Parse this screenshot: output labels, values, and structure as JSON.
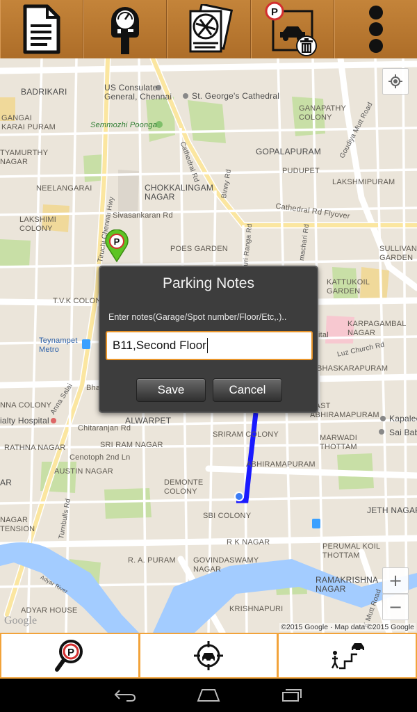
{
  "toolbar": {
    "items": [
      {
        "name": "notes",
        "icon": "document-icon"
      },
      {
        "name": "meter",
        "icon": "parking-meter-icon"
      },
      {
        "name": "maps",
        "icon": "folded-map-icon"
      },
      {
        "name": "clear",
        "icon": "parking-clear-trash-icon"
      },
      {
        "name": "overflow",
        "icon": "more-vert-icon"
      }
    ]
  },
  "map": {
    "labels": {
      "badrikari": "BADRIKARI",
      "us_consulate": "US Consulate\nGeneral, Chennai",
      "st_george": "St. George's Cathedral",
      "gangai": "GANGAI\nKARAI PURAM",
      "semmozhi": "Semmozhi Poonga",
      "ganapathy": "GANAPATHY\nCOLONY",
      "goudiya": "Goudiya Mutt Road",
      "tyamurthy": "TYAMURTHY\nNAGAR",
      "cathedral_rd_v": "Cathedral Rd",
      "gopalapuram": "GOPALAPURAM",
      "pudupet": "PUDUPET",
      "neelangarai": "NEELANGARAI",
      "chokkalingam": "CHOKKALINGAM\nNAGAR",
      "lakshmipuram": "LAKSHMIPURAM",
      "tiruchi": "Tiruchi Chennai Hwy",
      "sivasankaran": "Sivasankaran Rd",
      "binny": "Binny Rd",
      "cathedral_flyover": "Cathedral Rd Flyover",
      "lakshimi": "LAKSHIMI\nCOLONY",
      "poes": "POES GARDEN",
      "ranga": "uri Ranga Rd",
      "machari": "machari Rd",
      "sullivan": "SULLIVAN\nGARDEN",
      "tvk": "T.V.K COLONY",
      "kattukoil": "KATTUKOIL\nGARDEN",
      "teynampet": "Teynampet\nMetro",
      "karpagambal": "KARPAGAMBAL\nNAGAR",
      "luz": "Luz Church Rd",
      "bhaskarapuram": "BHASKARAPURAM",
      "bha": "Bha",
      "ital": "ital",
      "anna_salai": "Anna Salai",
      "nna_colony": "NNA COLONY",
      "alwarpet": "ALWARPET",
      "sriram": "SRIRAM COLONY",
      "east_abhi": "EAST\nABHIRAMAPURAM",
      "kapalee": "Kapalee",
      "sai_baba": "Sai Baba",
      "hospital": "ialty Hospital",
      "chitaranjan": "Chitaranjan Rd",
      "rathna": "RATHNA NAGAR",
      "sri_ram": "SRI RAM NAGAR",
      "cenotoph": "Cenotoph 2nd Ln",
      "austin": "AUSTIN NAGAR",
      "marwadi": "MARWADI\nTHOTTAM",
      "abhiramapuram": "ABHIRAMAPURAM",
      "demonte": "DEMONTE\nCOLONY",
      "ar": "AR",
      "jeth": "JETH NAGAR",
      "sbi": "SBI COLONY",
      "turnbulls": "Turnbulls Rd",
      "nagar_tension": "NAGAR\nTENSION",
      "rk_nagar": "R K NAGAR",
      "perumal": "PERUMAL KOIL\nTHOTTAM",
      "ra_puram": "R. A. PURAM",
      "govindaswamy": "GOVINDASWAMY\nNAGAR",
      "adyar_river": "Adyar River",
      "ramakrishna": "RAMAKRISHNA\nNAGAR",
      "adyar_house": "ADYAR HOUSE",
      "krishnapuri": "KRISHNAPURI",
      "kmutt": "K Mutt Road"
    },
    "zoom_in": "+",
    "zoom_out": "−",
    "google_logo": "Google",
    "copyright": "©2015 Google · Map data ©2015 Google"
  },
  "dialog": {
    "title": "Parking Notes",
    "hint": "Enter notes(Garage/Spot number/Floor/Etc,.)..",
    "input_value": "B11,Second Floor",
    "save_label": "Save",
    "cancel_label": "Cancel"
  },
  "bottombar": {
    "items": [
      {
        "name": "find-parking",
        "icon": "parking-search-icon"
      },
      {
        "name": "locate-car",
        "icon": "car-target-icon"
      },
      {
        "name": "walk-to-car",
        "icon": "walk-to-car-icon"
      }
    ]
  },
  "colors": {
    "toolbar": "#b8782f",
    "accent": "#f2a33a",
    "route": "#1a1aff",
    "map_bg": "#ebe5da"
  }
}
